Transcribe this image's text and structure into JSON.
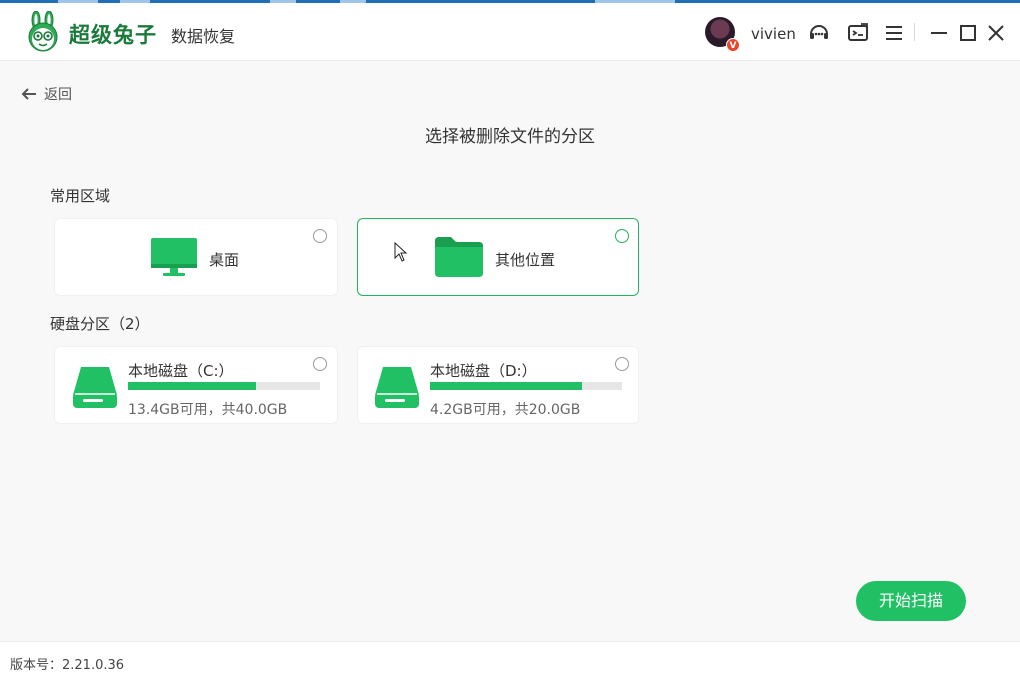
{
  "app": {
    "brand": "超级兔子",
    "product": "数据恢复"
  },
  "header": {
    "username": "vivien",
    "vip_badge": "V"
  },
  "nav": {
    "back_label": "返回"
  },
  "page": {
    "title": "选择被删除文件的分区"
  },
  "common_section": {
    "label": "常用区域",
    "items": [
      {
        "label": "桌面",
        "icon": "monitor-icon",
        "selected": false
      },
      {
        "label": "其他位置",
        "icon": "folder-icon",
        "selected": true
      }
    ]
  },
  "disk_section": {
    "label": "硬盘分区（2）",
    "disks": [
      {
        "name": "本地磁盘（C:）",
        "info": "13.4GB可用，共40.0GB",
        "used_fraction": 0.665
      },
      {
        "name": "本地磁盘（D:）",
        "info": "4.2GB可用，共20.0GB",
        "used_fraction": 0.79
      }
    ]
  },
  "actions": {
    "scan_label": "开始扫描"
  },
  "footer": {
    "version": "版本号：2.21.0.36"
  },
  "colors": {
    "accent": "#22c064",
    "brand": "#1a7a3a",
    "selected_border": "#22b35e"
  }
}
